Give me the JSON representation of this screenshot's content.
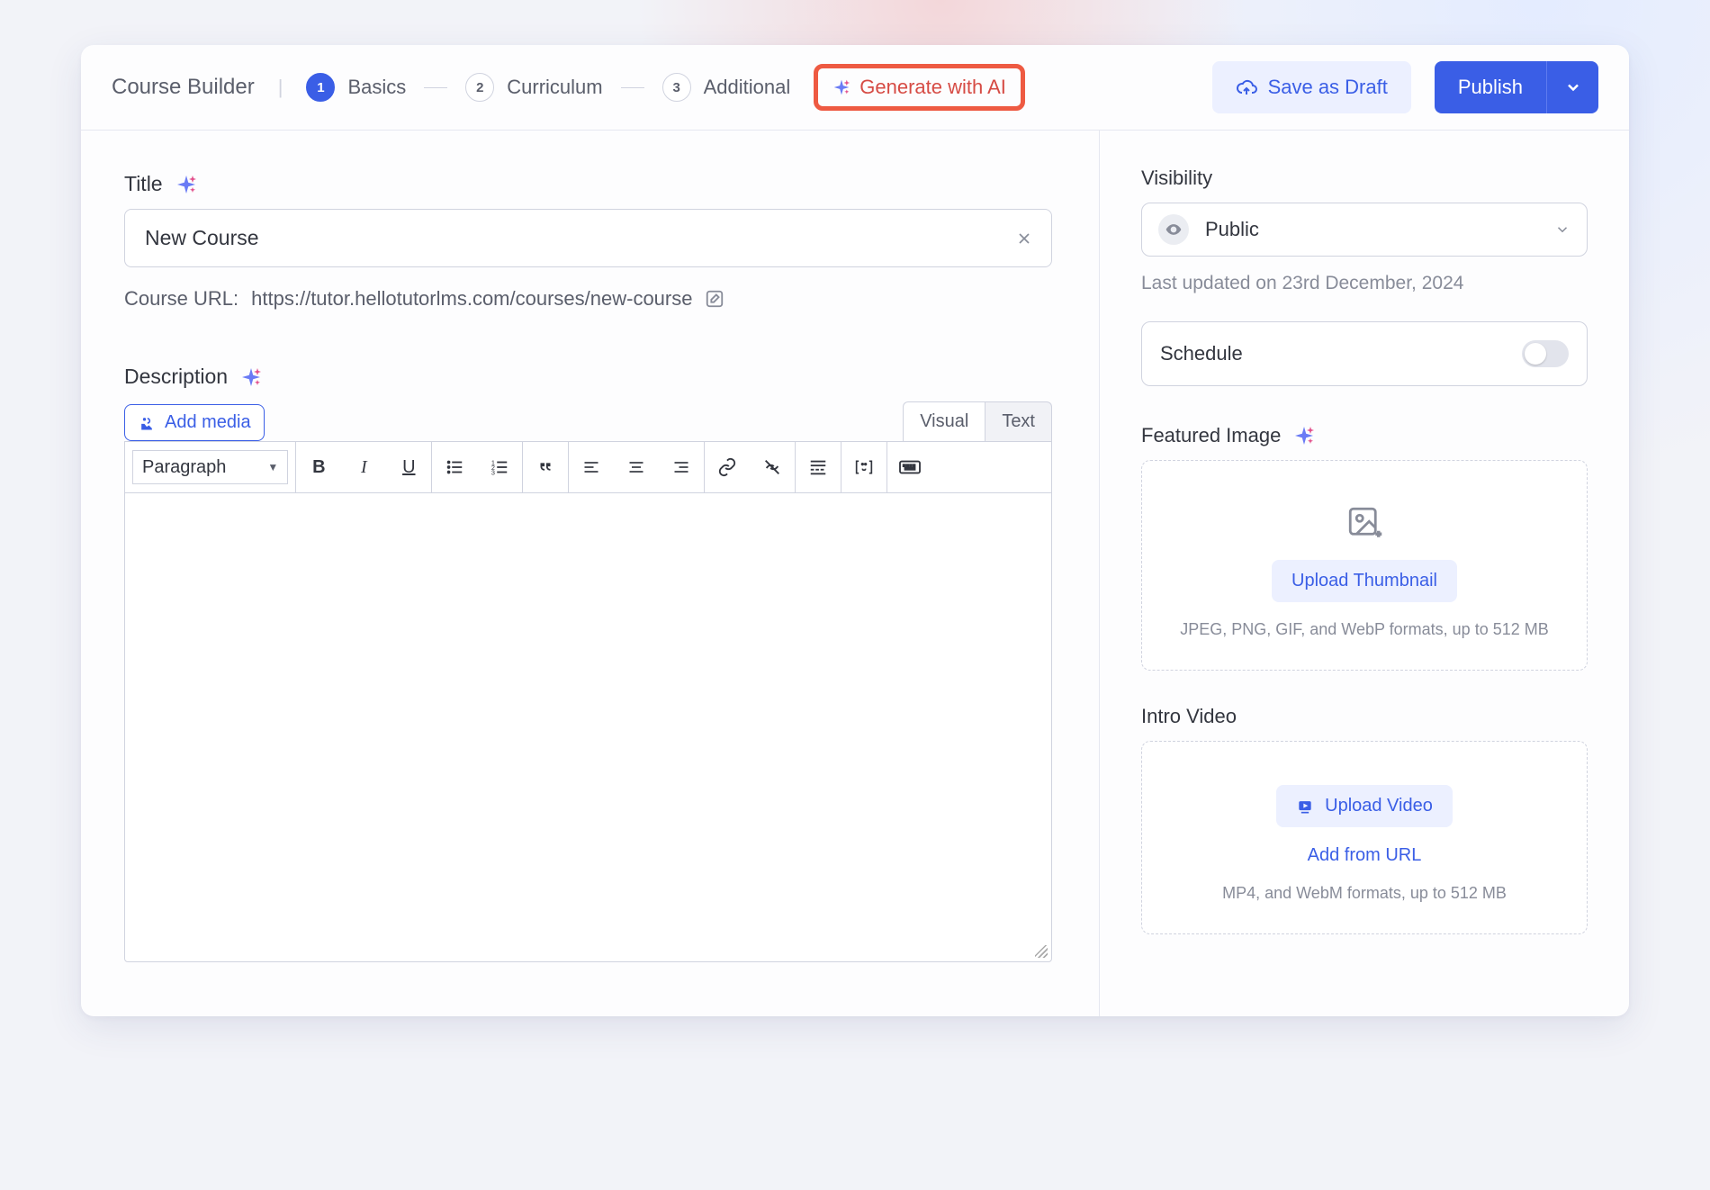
{
  "header": {
    "title": "Course Builder",
    "steps": [
      {
        "num": "1",
        "label": "Basics",
        "active": true
      },
      {
        "num": "2",
        "label": "Curriculum",
        "active": false
      },
      {
        "num": "3",
        "label": "Additional",
        "active": false
      }
    ],
    "generate_ai": "Generate with AI",
    "save_draft": "Save as Draft",
    "publish": "Publish"
  },
  "main": {
    "title_label": "Title",
    "title_value": "New Course",
    "url_label": "Course URL:",
    "url_value": "https://tutor.hellotutorlms.com/courses/new-course",
    "description_label": "Description",
    "add_media": "Add media",
    "editor_tabs": {
      "visual": "Visual",
      "text": "Text"
    },
    "paragraph_select": "Paragraph"
  },
  "side": {
    "visibility_label": "Visibility",
    "visibility_value": "Public",
    "updated": "Last updated on 23rd December, 2024",
    "schedule_label": "Schedule",
    "featured_label": "Featured Image",
    "upload_thumbnail": "Upload Thumbnail",
    "thumb_hint": "JPEG, PNG, GIF, and WebP formats, up to 512 MB",
    "intro_label": "Intro Video",
    "upload_video": "Upload Video",
    "add_from_url": "Add from URL",
    "video_hint": "MP4, and WebM formats, up to 512 MB"
  }
}
